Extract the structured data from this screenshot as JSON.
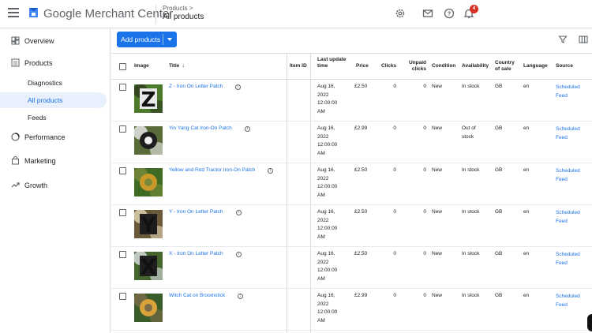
{
  "header": {
    "brand": "Google Merchant Center",
    "breadcrumb_parent": "Products >",
    "breadcrumb_current": "All products",
    "notification_count": "4"
  },
  "sidebar": {
    "items": [
      {
        "label": "Overview",
        "icon": "dashboard-icon"
      },
      {
        "label": "Products",
        "icon": "products-list-icon"
      },
      {
        "label": "Performance",
        "icon": "performance-icon"
      },
      {
        "label": "Marketing",
        "icon": "marketing-bag-icon"
      },
      {
        "label": "Growth",
        "icon": "growth-trend-icon"
      }
    ],
    "subitems": [
      {
        "label": "Diagnostics"
      },
      {
        "label": "All products"
      },
      {
        "label": "Feeds"
      }
    ]
  },
  "toolbar": {
    "add_label": "Add products"
  },
  "table": {
    "headers": {
      "image": "Image",
      "title": "Title",
      "item_id": "Item ID",
      "last_update": "Last update time",
      "price": "Price",
      "clicks": "Clicks",
      "unpaid_clicks": "Unpaid clicks",
      "condition": "Condition",
      "availability": "Availability",
      "country": "Country of sale",
      "language": "Language",
      "source": "Source"
    },
    "rows": [
      {
        "title": "Z - Iron On Letter Patch",
        "date": "Aug 16,",
        "year": "2022",
        "time": "12:00:00",
        "ampm": "AM",
        "price": "£2.50",
        "clicks": "0",
        "unpaid": "0",
        "condition": "New",
        "availability": "In stock",
        "availability2": "",
        "country": "GB",
        "language": "en",
        "source1": "Scheduled",
        "source2": "Feed",
        "thumb_letter": "Z"
      },
      {
        "title": "Yin Yang Cat Iron-On Patch",
        "date": "Aug 16,",
        "year": "2022",
        "time": "12:00:00",
        "ampm": "AM",
        "price": "£2.99",
        "clicks": "0",
        "unpaid": "0",
        "condition": "New",
        "availability": "Out of",
        "availability2": "stock",
        "country": "GB",
        "language": "en",
        "source1": "Scheduled",
        "source2": "Feed",
        "thumb_letter": ""
      },
      {
        "title": "Yellow and Red Tractor Iron-On Patch",
        "date": "Aug 16,",
        "year": "2022",
        "time": "12:00:00",
        "ampm": "AM",
        "price": "£2.50",
        "clicks": "0",
        "unpaid": "0",
        "condition": "New",
        "availability": "In stock",
        "availability2": "",
        "country": "GB",
        "language": "en",
        "source1": "Scheduled",
        "source2": "Feed",
        "thumb_letter": ""
      },
      {
        "title": "Y - Iron On Letter Patch",
        "date": "Aug 16,",
        "year": "2022",
        "time": "12:00:00",
        "ampm": "AM",
        "price": "£2.50",
        "clicks": "0",
        "unpaid": "0",
        "condition": "New",
        "availability": "In stock",
        "availability2": "",
        "country": "GB",
        "language": "en",
        "source1": "Scheduled",
        "source2": "Feed",
        "thumb_letter": "Y"
      },
      {
        "title": "X - Iron On Letter Patch",
        "date": "Aug 16,",
        "year": "2022",
        "time": "12:00:00",
        "ampm": "AM",
        "price": "£2.50",
        "clicks": "0",
        "unpaid": "0",
        "condition": "New",
        "availability": "In stock",
        "availability2": "",
        "country": "GB",
        "language": "en",
        "source1": "Scheduled",
        "source2": "Feed",
        "thumb_letter": "X"
      },
      {
        "title": "Witch Cat on Broomstick",
        "date": "Aug 16,",
        "year": "2022",
        "time": "12:00:00",
        "ampm": "AM",
        "price": "£2.99",
        "clicks": "0",
        "unpaid": "0",
        "condition": "New",
        "availability": "In stock",
        "availability2": "",
        "country": "GB",
        "language": "en",
        "source1": "Scheduled",
        "source2": "Feed",
        "thumb_letter": ""
      }
    ]
  },
  "colors": {
    "accent": "#1a73e8",
    "badge": "#d93025",
    "active_nav_bg": "#e8f0fe"
  }
}
